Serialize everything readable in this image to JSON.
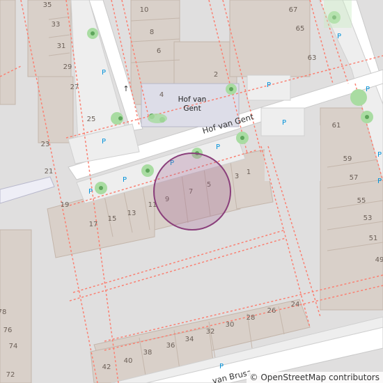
{
  "map": {
    "street_name": "Hof van Gent",
    "street_name_bottom": "van Bruss",
    "place_label": [
      "Hof van",
      "Gent"
    ],
    "parking_symbol": "P",
    "attribution": "© OpenStreetMap contributors",
    "colors": {
      "background": "#e0dfdf",
      "building": "#d9d0c9",
      "building_stroke": "#c4b6ab",
      "road": "#ffffff",
      "parking": "#eeeeee",
      "tree": "#a9dca2",
      "tree_dark": "#5ea55b",
      "square": "#dddde8",
      "path_dash": "#fa8072",
      "highlight_fill": "#a06090",
      "highlight_stroke": "#8a3f7b"
    }
  },
  "house_numbers": [
    "35",
    "33",
    "31",
    "29",
    "27",
    "25",
    "23",
    "21",
    "19",
    "17",
    "15",
    "13",
    "11",
    "9",
    "7",
    "5",
    "3",
    "1",
    "10",
    "8",
    "6",
    "4",
    "2",
    "67",
    "65",
    "63",
    "61",
    "59",
    "57",
    "55",
    "53",
    "51",
    "49",
    "78",
    "76",
    "74",
    "72",
    "42",
    "40",
    "38",
    "36",
    "34",
    "32",
    "30",
    "28",
    "26",
    "24"
  ]
}
